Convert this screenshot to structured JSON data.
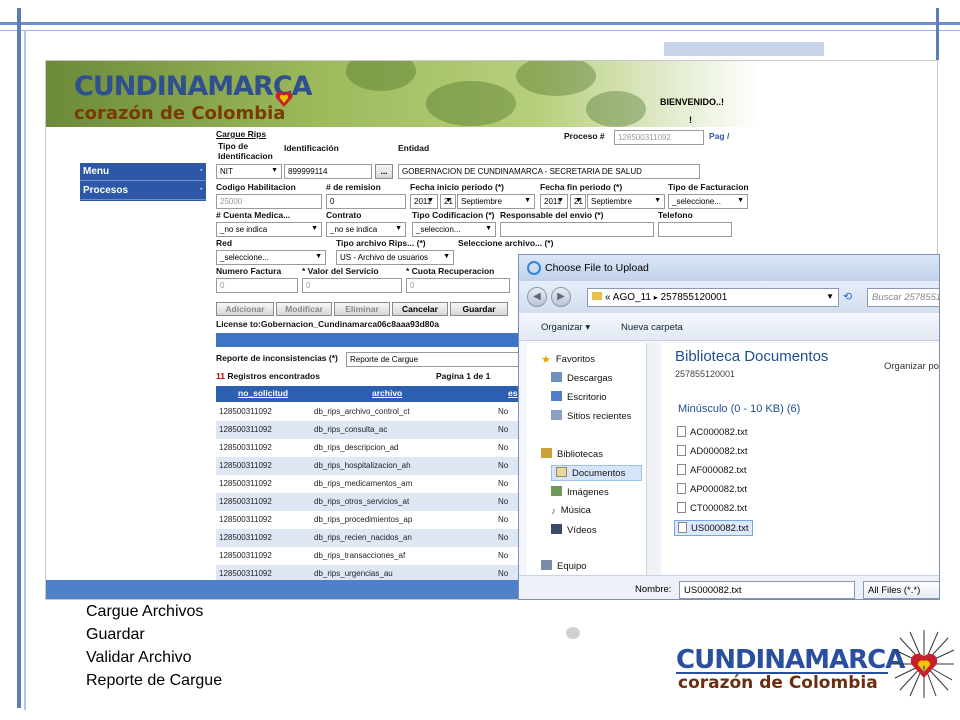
{
  "app": {
    "logo_line1": "CUNDINAMARCA",
    "logo_line2": "corazón de Colombia",
    "welcome": "BIENVENIDO..!",
    "welcome_mark": "!",
    "menu": [
      "Menu",
      "Procesos"
    ],
    "form": {
      "title": "Cargue Rips",
      "tipo_id_label": "Tipo de Identificacion",
      "identificacion_label": "Identificación",
      "entidad_label": "Entidad",
      "proceso_label": "Proceso #",
      "proceso_value": "128500311092",
      "pag_label": "Pag /",
      "tipo_id_value": "NIT",
      "identificacion_value": "899999114",
      "lookup_button": "...",
      "entidad_value": "GOBERNACION DE CUNDINAMARCA - SECRETARIA DE SALUD",
      "codigo_label": "Codigo Habilitacion",
      "remision_label": "# de remision",
      "fecha_inicio_label": "Fecha inicio periodo (*)",
      "fecha_fin_label": "Fecha fin periodo (*)",
      "tipo_fact_label": "Tipo de Facturacion",
      "codigo_value": "25000",
      "remision_value": "0",
      "fi_year": "2011",
      "fi_day": "21",
      "fi_month": "Septiembre",
      "ff_year": "2011",
      "ff_day": "21",
      "ff_month": "Septiembre",
      "tipo_fact_value": "_seleccione...",
      "cuenta_label": "# Cuenta Medica...",
      "contrato_label": "Contrato",
      "tipo_cod_label": "Tipo Codificacion (*)",
      "responsable_label": "Responsable del envio (*)",
      "telefono_label": "Telefono",
      "cuenta_value": "_no se indica",
      "contrato_value": "_no se indica",
      "tipo_cod_value": "_seleccion...",
      "red_label": "Red",
      "tipo_archivo_label": "Tipo archivo Rips... (*)",
      "seleccione_archivo_label": "Seleccione archivo... (*)",
      "red_value": "_seleccione...",
      "tipo_archivo_value": "US - Archivo de usuarios",
      "numero_factura_label": "Numero Factura",
      "valor_servicio_label": "* Valor del Servicio",
      "cuota_label": "* Cuota Recuperacion",
      "numero_factura_value": "0",
      "valor_servicio_value": "0",
      "cuota_value": "0"
    },
    "buttons": {
      "adicionar": "Adicionar",
      "modificar": "Modificar",
      "eliminar": "Eliminar",
      "cancelar": "Cancelar",
      "guardar": "Guardar"
    },
    "license": "License to:Gobernacion_Cundinamarca06c8aaa93d80a",
    "reporte_label": "Reporte de inconsistencias (*)",
    "reporte_value": "Reporte de Cargue",
    "registros_count": "11",
    "registros_text": "Registros encontrados",
    "pagina": "Pagina 1 de 1",
    "grid": {
      "headers": [
        "no_solicitud",
        "archivo",
        "es"
      ],
      "rows": [
        [
          "128500311092",
          "db_rips_archivo_control_ct",
          "No"
        ],
        [
          "128500311092",
          "db_rips_consulta_ac",
          "No"
        ],
        [
          "128500311092",
          "db_rips_descripcion_ad",
          "No"
        ],
        [
          "128500311092",
          "db_rips_hospitalizacion_ah",
          "No"
        ],
        [
          "128500311092",
          "db_rips_medicamentos_am",
          "No"
        ],
        [
          "128500311092",
          "db_rips_otros_servicios_at",
          "No"
        ],
        [
          "128500311092",
          "db_rips_procedimientos_ap",
          "No"
        ],
        [
          "128500311092",
          "db_rips_recien_nacidos_an",
          "No"
        ],
        [
          "128500311092",
          "db_rips_transacciones_af",
          "No"
        ],
        [
          "128500311092",
          "db_rips_urgencias_au",
          "No"
        ]
      ]
    }
  },
  "dialog": {
    "title": "Choose File to Upload",
    "address_prefix": "«",
    "address_folder": "AGO_11",
    "address_sep": "▸",
    "address_sub": "257855120001",
    "search_placeholder": "Buscar 2578551",
    "organizar": "Organizar",
    "nueva_carpeta": "Nueva carpeta",
    "nav": [
      "Favoritos",
      "Descargas",
      "Escritorio",
      "Sitios recientes",
      "Bibliotecas",
      "Documentos",
      "Imágenes",
      "Música",
      "Vídeos",
      "Equipo"
    ],
    "library_title": "Biblioteca Documentos",
    "library_sub": "257855120001",
    "organizar_por": "Organizar po",
    "group_header": "Minúsculo (0 - 10 KB) (6)",
    "files": [
      "AC000082.txt",
      "AD000082.txt",
      "AF000082.txt",
      "AP000082.txt",
      "CT000082.txt",
      "US000082.txt"
    ],
    "selected_file": "US000082.txt",
    "nombre_label": "Nombre:",
    "nombre_value": "US000082.txt",
    "filter_value": "All Files (*.*)"
  },
  "captions": [
    "Cargue Archivos",
    "Guardar",
    "Validar Archivo",
    "Reporte de Cargue"
  ],
  "footer_logo": {
    "line1": "CUNDINAMARCA",
    "line2": "corazón de Colombia"
  }
}
